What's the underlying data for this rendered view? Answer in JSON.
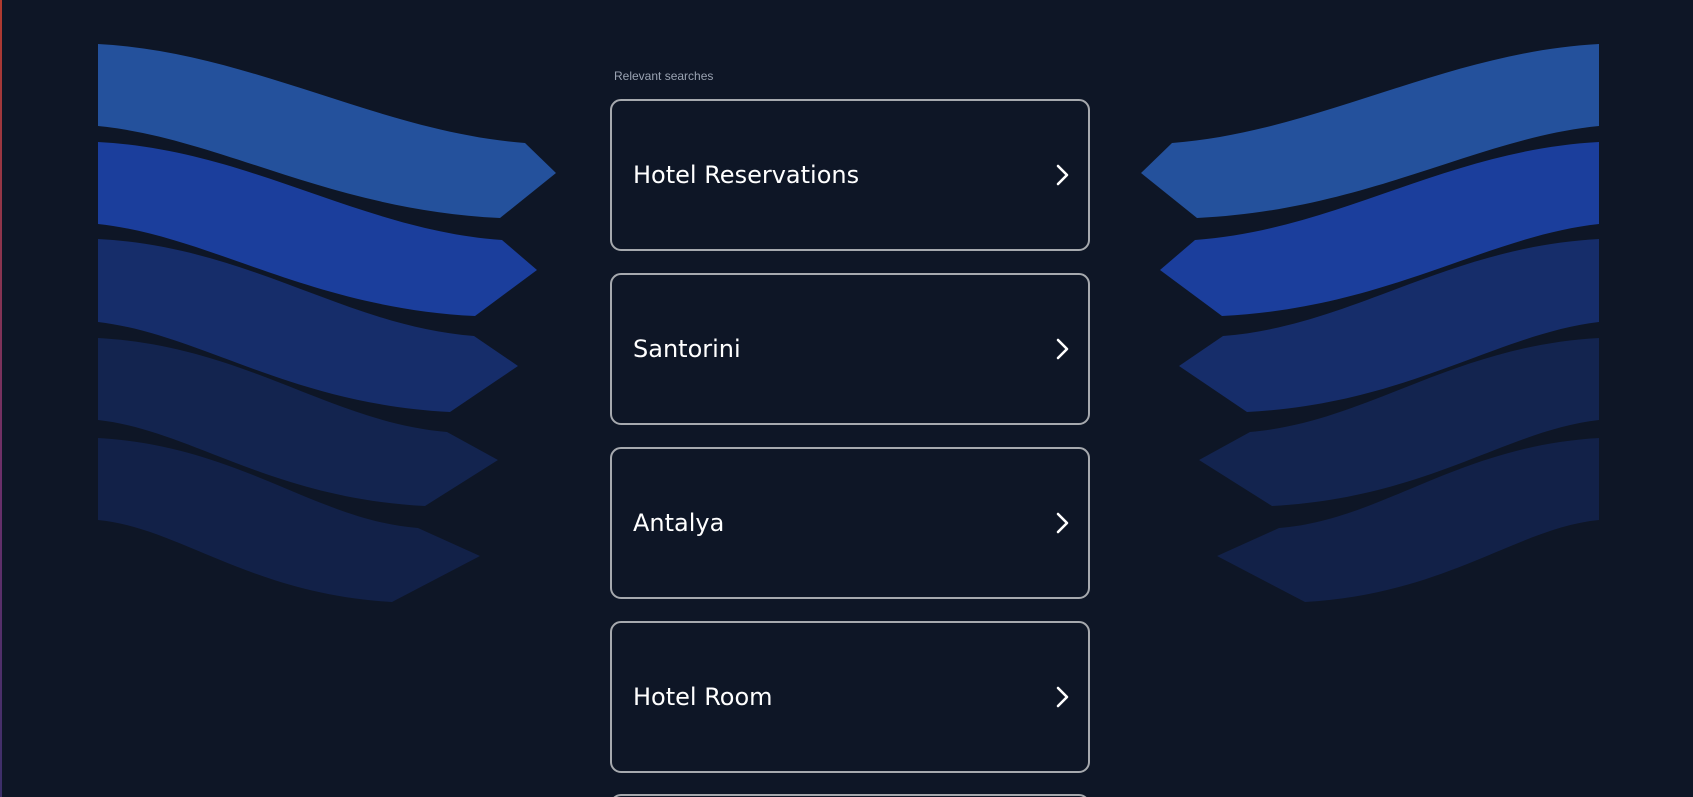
{
  "header": {
    "section_label": "Relevant searches"
  },
  "results": [
    {
      "label": "Hotel Reservations",
      "icon": "chevron-right-icon"
    },
    {
      "label": "Santorini",
      "icon": "chevron-right-icon"
    },
    {
      "label": "Antalya",
      "icon": "chevron-right-icon"
    },
    {
      "label": "Hotel Room",
      "icon": "chevron-right-icon"
    }
  ],
  "colors": {
    "background": "#0e1626",
    "card_border": "#a6a9ae",
    "text": "#ffffff",
    "stripe_1": "#24519c",
    "stripe_2": "#1b3e9c",
    "stripe_3": "#162d6a",
    "stripe_4": "#13244f",
    "stripe_5": "#122148"
  }
}
